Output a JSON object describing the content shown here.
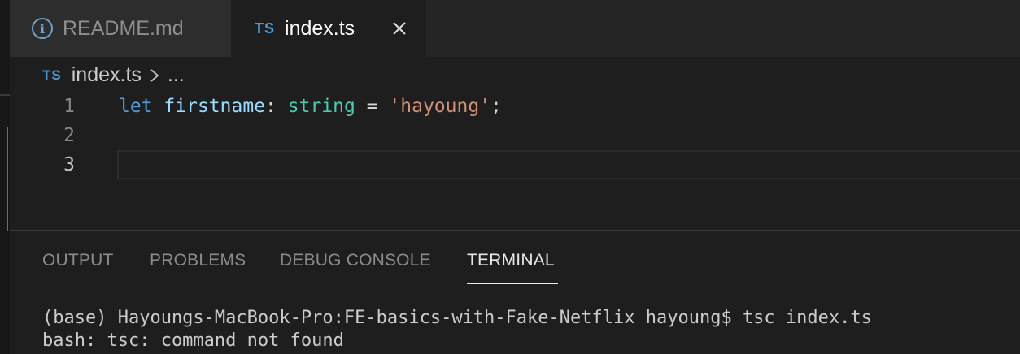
{
  "tabs": [
    {
      "label": "README.md",
      "icon": "info-icon",
      "active": false
    },
    {
      "label": "index.ts",
      "icon": "ts-icon",
      "active": true
    }
  ],
  "ts_badge": "TS",
  "info_glyph": "i",
  "breadcrumb": {
    "file": "index.ts",
    "more": "..."
  },
  "editor": {
    "line_numbers": [
      "1",
      "2",
      "3"
    ],
    "current_line": "3",
    "line1": {
      "kw": "let",
      "name": "firstname",
      "colon": ":",
      "type": "string",
      "eq": "=",
      "value": "'hayoung'",
      "semi": ";"
    }
  },
  "panel": {
    "tabs": [
      "OUTPUT",
      "PROBLEMS",
      "DEBUG CONSOLE",
      "TERMINAL"
    ],
    "active_tab": "TERMINAL",
    "terminal_lines": [
      "(base) Hayoungs-MacBook-Pro:FE-basics-with-Fake-Netflix hayoung$ tsc index.ts",
      "bash: tsc: command not found"
    ]
  },
  "colors": {
    "accent": "#2f7bd0",
    "ts_blue": "#4e9ad6",
    "string": "#ce9178",
    "type": "#4ec9b0",
    "keyword": "#569cd6"
  }
}
